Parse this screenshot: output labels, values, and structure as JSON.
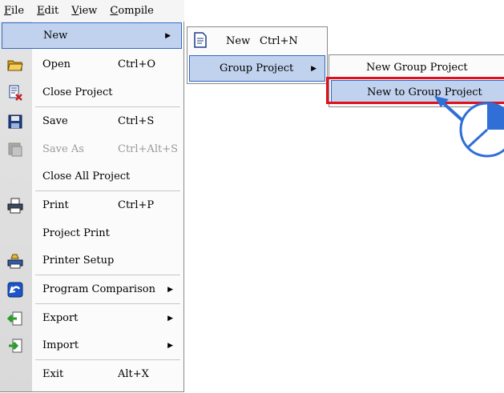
{
  "menubar": [
    "File",
    "Edit",
    "View",
    "Compile"
  ],
  "file_menu": {
    "items": [
      {
        "label": "New",
        "shortcut": "",
        "icon": "",
        "arrow": true
      },
      {
        "label": "Open",
        "shortcut": "Ctrl+O",
        "icon": "open-folder-icon"
      },
      {
        "label": "Close Project",
        "shortcut": "",
        "icon": "close-project-icon"
      },
      {
        "label": "Save",
        "shortcut": "Ctrl+S",
        "icon": "save-disk-icon"
      },
      {
        "label": "Save As",
        "shortcut": "Ctrl+Alt+S",
        "icon": "save-as-icon",
        "disabled": true
      },
      {
        "label": "Close All Project",
        "shortcut": "",
        "icon": ""
      },
      {
        "label": "Print",
        "shortcut": "Ctrl+P",
        "icon": "printer-icon"
      },
      {
        "label": "Project Print",
        "shortcut": "",
        "icon": ""
      },
      {
        "label": "Printer Setup",
        "shortcut": "",
        "icon": "printer-setup-icon"
      },
      {
        "label": "Program Comparison",
        "shortcut": "",
        "icon": "program-comparison-icon",
        "arrow": true
      },
      {
        "label": "Export",
        "shortcut": "",
        "icon": "export-icon",
        "arrow": true
      },
      {
        "label": "Import",
        "shortcut": "",
        "icon": "import-icon",
        "arrow": true
      },
      {
        "label": "Exit",
        "shortcut": "Alt+X",
        "icon": ""
      }
    ]
  },
  "new_submenu": {
    "items": [
      {
        "label": "New",
        "shortcut": "Ctrl+N",
        "icon": "new-document-icon"
      },
      {
        "label": "Group Project",
        "arrow": true
      }
    ]
  },
  "group_submenu": {
    "items": [
      {
        "label": "New Group Project"
      },
      {
        "label": "New to Group Project"
      }
    ]
  },
  "colors": {
    "highlight": "#c1d2ee",
    "highlight_border": "#316ac5",
    "callout": "#e0101c",
    "pointer": "#2f6fd6"
  }
}
